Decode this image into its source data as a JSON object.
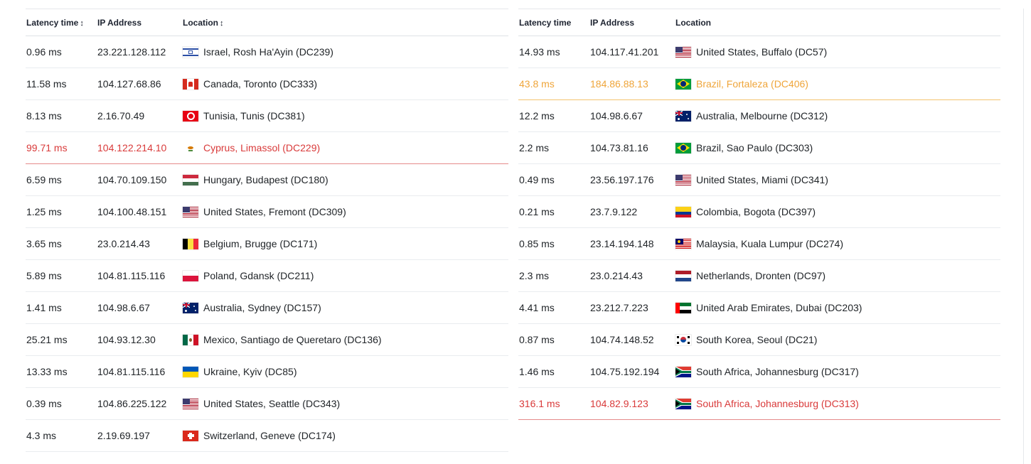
{
  "tables": {
    "left": {
      "headers": {
        "latency": "Latency time",
        "latency_sort_icon": "↕",
        "ip": "IP Address",
        "location": "Location",
        "location_sort_icon": "↕"
      },
      "rows": [
        {
          "latency": "0.96 ms",
          "ip": "23.221.128.112",
          "location": "Israel, Rosh Ha'Ayin (DC239)",
          "flag": "il",
          "status": "normal"
        },
        {
          "latency": "11.58 ms",
          "ip": "104.127.68.86",
          "location": "Canada, Toronto (DC333)",
          "flag": "ca",
          "status": "normal"
        },
        {
          "latency": "8.13 ms",
          "ip": "2.16.70.49",
          "location": "Tunisia, Tunis (DC381)",
          "flag": "tn",
          "status": "normal"
        },
        {
          "latency": "99.71 ms",
          "ip": "104.122.214.10",
          "location": "Cyprus, Limassol (DC229)",
          "flag": "cy",
          "status": "slow"
        },
        {
          "latency": "6.59 ms",
          "ip": "104.70.109.150",
          "location": "Hungary, Budapest (DC180)",
          "flag": "hu",
          "status": "normal"
        },
        {
          "latency": "1.25 ms",
          "ip": "104.100.48.151",
          "location": "United States, Fremont (DC309)",
          "flag": "us",
          "status": "normal"
        },
        {
          "latency": "3.65 ms",
          "ip": "23.0.214.43",
          "location": "Belgium, Brugge (DC171)",
          "flag": "be",
          "status": "normal"
        },
        {
          "latency": "5.89 ms",
          "ip": "104.81.115.116",
          "location": "Poland, Gdansk (DC211)",
          "flag": "pl",
          "status": "normal"
        },
        {
          "latency": "1.41 ms",
          "ip": "104.98.6.67",
          "location": "Australia, Sydney (DC157)",
          "flag": "au",
          "status": "normal"
        },
        {
          "latency": "25.21 ms",
          "ip": "104.93.12.30",
          "location": "Mexico, Santiago de Queretaro (DC136)",
          "flag": "mx",
          "status": "normal"
        },
        {
          "latency": "13.33 ms",
          "ip": "104.81.115.116",
          "location": "Ukraine, Kyiv (DC85)",
          "flag": "ua",
          "status": "normal"
        },
        {
          "latency": "0.39 ms",
          "ip": "104.86.225.122",
          "location": "United States, Seattle (DC343)",
          "flag": "us",
          "status": "normal"
        },
        {
          "latency": "4.3 ms",
          "ip": "2.19.69.197",
          "location": "Switzerland, Geneve (DC174)",
          "flag": "ch",
          "status": "normal"
        }
      ]
    },
    "right": {
      "headers": {
        "latency": "Latency time",
        "ip": "IP Address",
        "location": "Location"
      },
      "rows": [
        {
          "latency": "14.93 ms",
          "ip": "104.117.41.201",
          "location": "United States, Buffalo (DC57)",
          "flag": "us",
          "status": "normal"
        },
        {
          "latency": "43.8 ms",
          "ip": "184.86.88.13",
          "location": "Brazil, Fortaleza (DC406)",
          "flag": "br",
          "status": "warn"
        },
        {
          "latency": "12.2 ms",
          "ip": "104.98.6.67",
          "location": "Australia, Melbourne (DC312)",
          "flag": "au",
          "status": "normal"
        },
        {
          "latency": "2.2 ms",
          "ip": "104.73.81.16",
          "location": "Brazil, Sao Paulo (DC303)",
          "flag": "br",
          "status": "normal"
        },
        {
          "latency": "0.49 ms",
          "ip": "23.56.197.176",
          "location": "United States, Miami (DC341)",
          "flag": "us",
          "status": "normal"
        },
        {
          "latency": "0.21 ms",
          "ip": "23.7.9.122",
          "location": "Colombia, Bogota (DC397)",
          "flag": "co",
          "status": "normal"
        },
        {
          "latency": "0.85 ms",
          "ip": "23.14.194.148",
          "location": "Malaysia, Kuala Lumpur (DC274)",
          "flag": "my",
          "status": "normal"
        },
        {
          "latency": "2.3 ms",
          "ip": "23.0.214.43",
          "location": "Netherlands, Dronten (DC97)",
          "flag": "nl",
          "status": "normal"
        },
        {
          "latency": "4.41 ms",
          "ip": "23.212.7.223",
          "location": "United Arab Emirates, Dubai (DC203)",
          "flag": "ae",
          "status": "normal"
        },
        {
          "latency": "0.87 ms",
          "ip": "104.74.148.52",
          "location": "South Korea, Seoul (DC21)",
          "flag": "kr",
          "status": "normal"
        },
        {
          "latency": "1.46 ms",
          "ip": "104.75.192.194",
          "location": "South Africa, Johannesburg (DC317)",
          "flag": "za",
          "status": "normal"
        },
        {
          "latency": "316.1 ms",
          "ip": "104.82.9.123",
          "location": "South Africa, Johannesburg (DC313)",
          "flag": "za",
          "status": "slow"
        }
      ]
    }
  },
  "colors": {
    "slow": "#d93a3a",
    "warn": "#efa53a",
    "text": "#212529"
  },
  "flag_names": {
    "il": "israel-flag-icon",
    "ca": "canada-flag-icon",
    "tn": "tunisia-flag-icon",
    "cy": "cyprus-flag-icon",
    "hu": "hungary-flag-icon",
    "us": "united-states-flag-icon",
    "be": "belgium-flag-icon",
    "pl": "poland-flag-icon",
    "au": "australia-flag-icon",
    "mx": "mexico-flag-icon",
    "ua": "ukraine-flag-icon",
    "ch": "switzerland-flag-icon",
    "br": "brazil-flag-icon",
    "co": "colombia-flag-icon",
    "my": "malaysia-flag-icon",
    "nl": "netherlands-flag-icon",
    "ae": "uae-flag-icon",
    "kr": "south-korea-flag-icon",
    "za": "south-africa-flag-icon"
  }
}
